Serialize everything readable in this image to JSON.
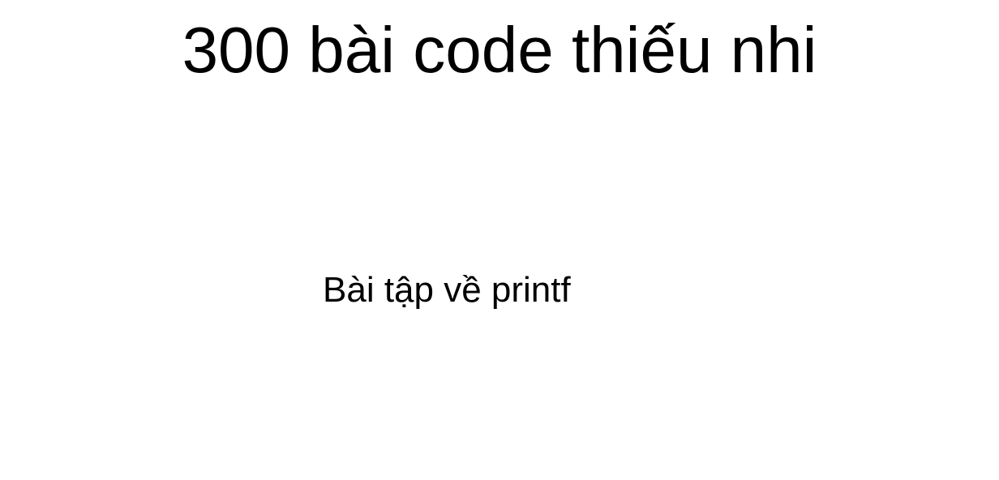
{
  "slide": {
    "title": "300 bài code thiếu nhi",
    "subtitle": "Bài tập về printf"
  }
}
